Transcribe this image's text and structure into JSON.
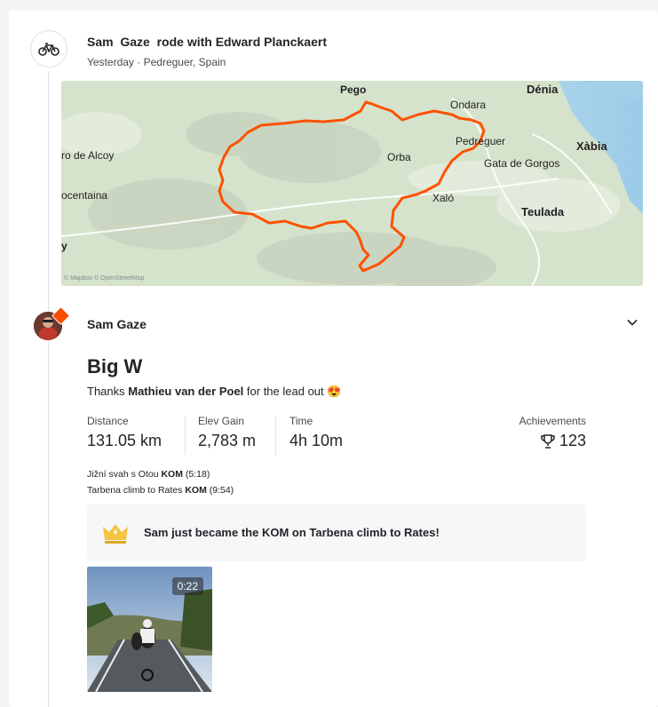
{
  "group": {
    "title": "Sam  Gaze  rode with Edward Planckaert",
    "meta": "Yesterday · Pedreguer, Spain",
    "icon": "bike-icon"
  },
  "map": {
    "labels": [
      "Pego",
      "Dénia",
      "Ondara",
      "Pedreguer",
      "Xàbia",
      "Orba",
      "Gata de Gorgos",
      "ro de Alcoy",
      "ocentaina",
      "Xaló",
      "Teulada",
      "y"
    ],
    "attribution": "© Mapbox © OpenStreetMap",
    "route_color": "#fc5200"
  },
  "activity": {
    "athlete": "Sam Gaze",
    "title": "Big W",
    "desc_prefix": "Thanks ",
    "desc_mention": "Mathieu van der Poel",
    "desc_suffix": " for the lead out 😍",
    "stats": [
      {
        "label": "Distance",
        "value": "131.05 km"
      },
      {
        "label": "Elev Gain",
        "value": "2,783 m"
      },
      {
        "label": "Time",
        "value": "4h 10m"
      }
    ],
    "achievements": {
      "label": "Achievements",
      "value": "123",
      "icon": "trophy-icon"
    },
    "segments": [
      {
        "name": "Jižní svah s Otou",
        "award": "KOM",
        "time": "(5:18)"
      },
      {
        "name": "Tarbena climb to Rates",
        "award": "KOM",
        "time": "(9:54)"
      }
    ],
    "kom_banner": "Sam just became the KOM on Tarbena climb to Rates!",
    "video_duration": "0:22"
  },
  "colors": {
    "accent": "#fc4c02",
    "crown": "#f5c443"
  }
}
